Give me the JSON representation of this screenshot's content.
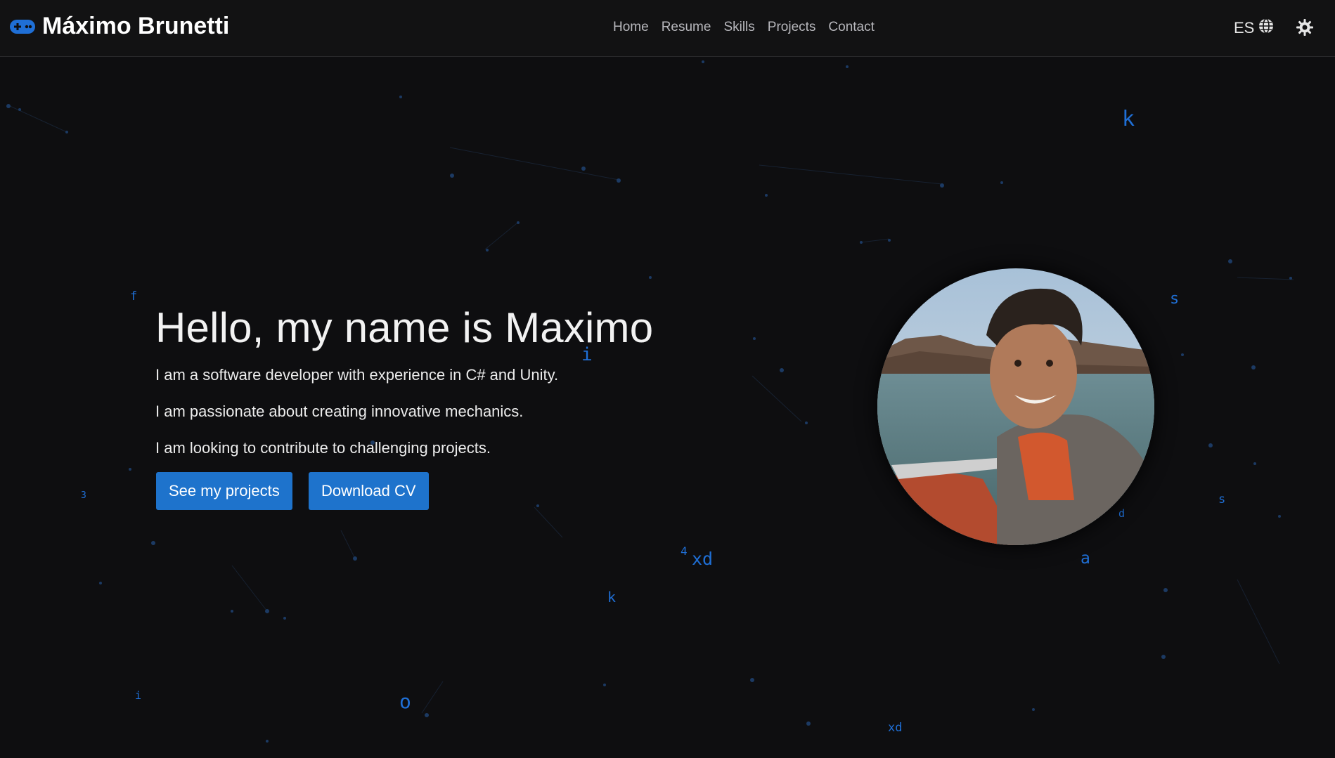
{
  "header": {
    "brand_icon": "gamepad-icon",
    "brand_name": "Máximo Brunetti",
    "nav": [
      {
        "label": "Home"
      },
      {
        "label": "Resume"
      },
      {
        "label": "Skills"
      },
      {
        "label": "Projects"
      },
      {
        "label": "Contact"
      }
    ],
    "lang_label": "ES",
    "lang_icon": "globe-icon",
    "theme_icon": "sun-gear-icon"
  },
  "hero": {
    "title": "Hello, my name is Maximo",
    "lines": [
      "I am a software developer with experience in C# and Unity.",
      "I am passionate about creating innovative mechanics.",
      "I am looking to contribute to challenging projects."
    ],
    "primary_button": "See my projects",
    "secondary_button": "Download CV"
  },
  "floating_chars": [
    "k",
    "s",
    "f",
    "i",
    "s",
    "d",
    "3",
    "4",
    "xd",
    "a",
    "k",
    "i",
    "o",
    "xd"
  ],
  "colors": {
    "background": "#0e0e10",
    "accent": "#1e73cc",
    "floating_char": "#1f6fd6"
  }
}
